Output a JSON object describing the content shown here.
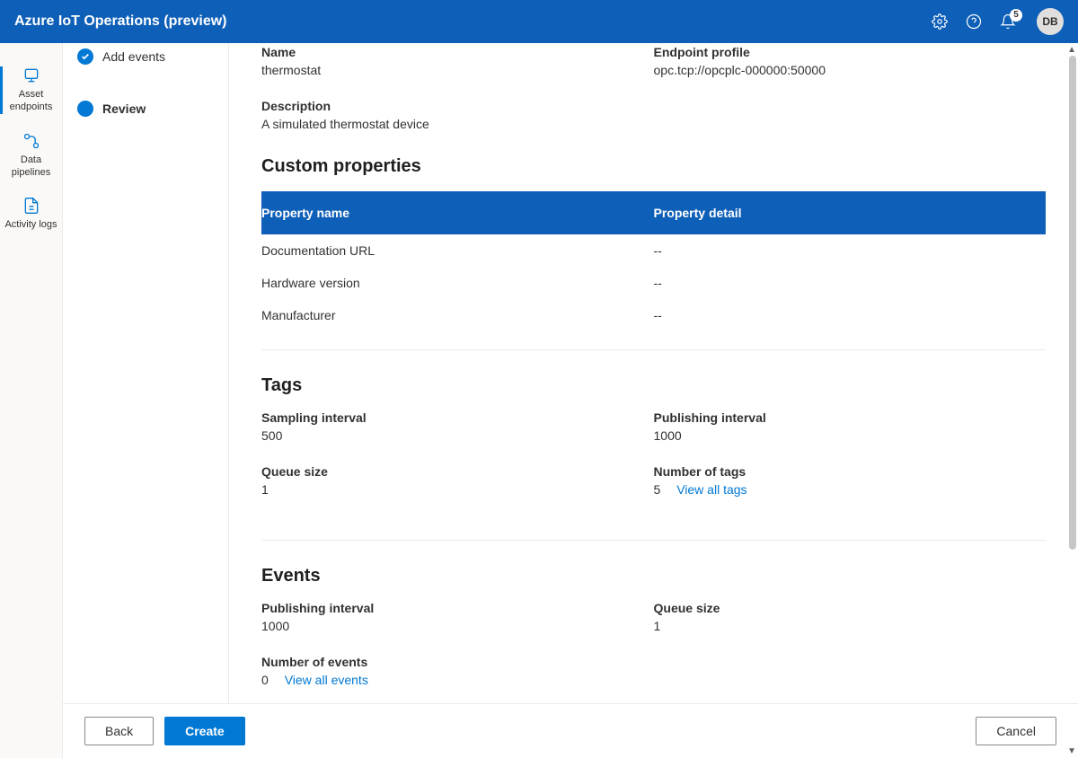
{
  "header": {
    "title": "Azure IoT Operations (preview)",
    "notification_count": "5",
    "avatar_initials": "DB"
  },
  "left_sidebar": {
    "items": [
      {
        "label": "Asset endpoints"
      },
      {
        "label": "Data pipelines"
      },
      {
        "label": "Activity logs"
      }
    ]
  },
  "steps": {
    "add_events_label": "Add events",
    "review_label": "Review"
  },
  "basics": {
    "name_label": "Name",
    "name_value": "thermostat",
    "endpoint_label": "Endpoint profile",
    "endpoint_value": "opc.tcp://opcplc-000000:50000",
    "description_label": "Description",
    "description_value": "A simulated thermostat device"
  },
  "custom_properties": {
    "heading": "Custom properties",
    "col_name": "Property name",
    "col_detail": "Property detail",
    "rows": [
      {
        "name": "Documentation URL",
        "detail": "--"
      },
      {
        "name": "Hardware version",
        "detail": "--"
      },
      {
        "name": "Manufacturer",
        "detail": "--"
      }
    ]
  },
  "tags": {
    "heading": "Tags",
    "sampling_interval_label": "Sampling interval",
    "sampling_interval_value": "500",
    "publishing_interval_label": "Publishing interval",
    "publishing_interval_value": "1000",
    "queue_size_label": "Queue size",
    "queue_size_value": "1",
    "number_label": "Number of tags",
    "number_value": "5",
    "view_all_link": "View all tags"
  },
  "events": {
    "heading": "Events",
    "publishing_interval_label": "Publishing interval",
    "publishing_interval_value": "1000",
    "queue_size_label": "Queue size",
    "queue_size_value": "1",
    "number_label": "Number of events",
    "number_value": "0",
    "view_all_link": "View all events"
  },
  "footer": {
    "back_label": "Back",
    "create_label": "Create",
    "cancel_label": "Cancel"
  }
}
